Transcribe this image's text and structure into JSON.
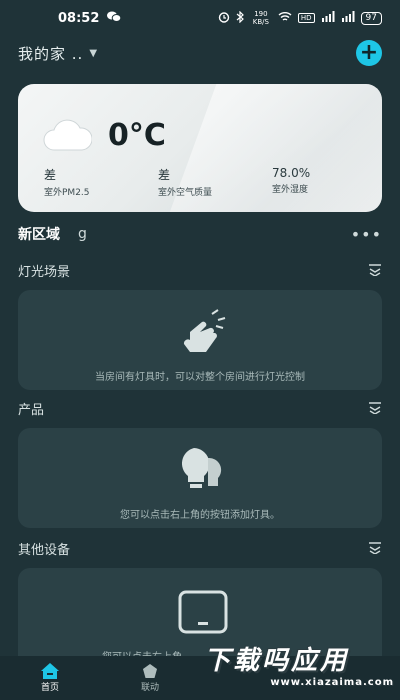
{
  "status_bar": {
    "time": "08:52",
    "net_speed": "190 KB/S",
    "battery": "97"
  },
  "header": {
    "home_title": "我的家 ..",
    "add_icon": "plus-circle-icon"
  },
  "weather": {
    "icon": "cloud-icon",
    "temperature": "0°C",
    "stats": [
      {
        "value": "差",
        "label": "室外PM2.5"
      },
      {
        "value": "差",
        "label": "室外空气质量"
      },
      {
        "value": "78.0%",
        "label": "室外湿度"
      }
    ]
  },
  "region": {
    "name": "新区域",
    "sub": "g",
    "more_icon": "more-dots-icon"
  },
  "sections": [
    {
      "title": "灯光场景",
      "hint": "当房间有灯具时，可以对整个房间进行灯光控制",
      "icon": "touch-hand-icon"
    },
    {
      "title": "产品",
      "hint": "您可以点击右上角的按钮添加灯具。",
      "icon": "bulb-icon"
    },
    {
      "title": "其他设备",
      "hint": "您可以点击右上角",
      "icon": "tablet-icon"
    }
  ],
  "bottom_nav": [
    {
      "label": "首页",
      "icon": "home-icon",
      "active": true
    },
    {
      "label": "联动",
      "icon": "pentagon-icon",
      "active": false
    }
  ],
  "watermark": {
    "title": "下载吗应用",
    "url": "www.xiazaima.com"
  },
  "colors": {
    "background": "#1f3338",
    "panel": "#2b4146",
    "accent": "#1ec6e6"
  }
}
